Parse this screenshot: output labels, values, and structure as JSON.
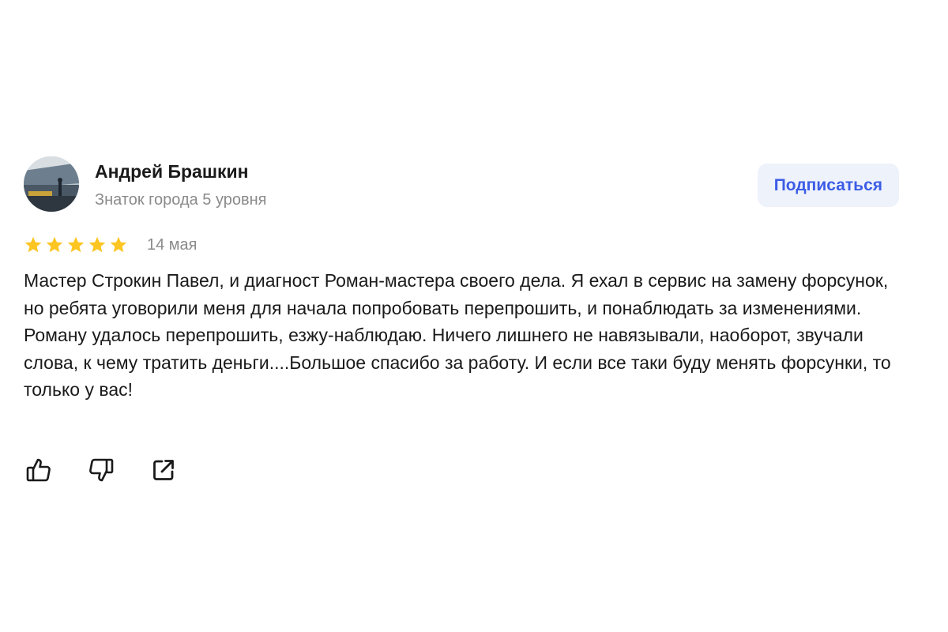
{
  "author": {
    "name": "Андрей Брашкин",
    "level": "Знаток города 5 уровня",
    "avatar_icon": "user-avatar-photo"
  },
  "subscribe_label": "Подписаться",
  "rating": {
    "stars": 5,
    "max": 5,
    "color": "#fcc521"
  },
  "date": "14 мая",
  "review_text": "Мастер Строкин Павел, и диагност Роман-мастера своего дела. Я ехал в сервис на замену форсунок, но ребята уговорили меня для начала попробовать перепрошить, и понаблюдать за изменениями. Роману удалось перепрошить, езжу-наблюдаю. Ничего лишнего не навязывали, наоборот, звучали слова, к чему тратить деньги....Большое спасибо за работу. И если все таки буду менять форсунки, то только у вас!",
  "actions": [
    {
      "icon": "thumbs-up-icon"
    },
    {
      "icon": "thumbs-down-icon"
    },
    {
      "icon": "share-icon"
    }
  ],
  "colors": {
    "accent": "#3b5ce6",
    "button_bg": "#eef2fb",
    "muted_text": "#8a8a8a"
  }
}
